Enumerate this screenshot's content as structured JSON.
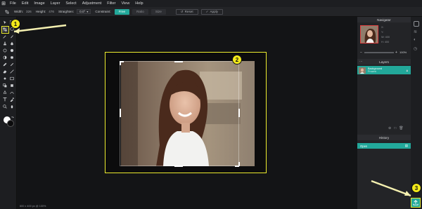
{
  "menu": [
    "File",
    "Edit",
    "Image",
    "Layer",
    "Select",
    "Adjustment",
    "Filter",
    "View",
    "Help"
  ],
  "options": {
    "width_label": "Width:",
    "width_value": "326",
    "height_label": "Height:",
    "height_value": "476",
    "straighten_label": "Straighten:",
    "straighten_value": "0.0°",
    "constraint_label": "Constraint:",
    "free_label": "Free",
    "ratio_label": "Ratio",
    "size_label": "Size",
    "reset_label": "Reset",
    "apply_label": "Apply"
  },
  "panels": {
    "navigator_title": "Navigator",
    "navigator_info": [
      "X:",
      "Y:",
      "W:",
      "H:"
    ],
    "navigator_values": [
      "",
      "",
      "400",
      "400"
    ],
    "zoom_value": "100%",
    "layers_title": "Layers",
    "layer_name": "Background",
    "layer_sub": "Frozen",
    "history_title": "History",
    "history_item": "Open"
  },
  "status": "600 x 400 px @ 100%",
  "badges": [
    "1",
    "2",
    "3"
  ],
  "colors": {
    "accent": "#22a89a",
    "highlight": "#ecec2e"
  }
}
